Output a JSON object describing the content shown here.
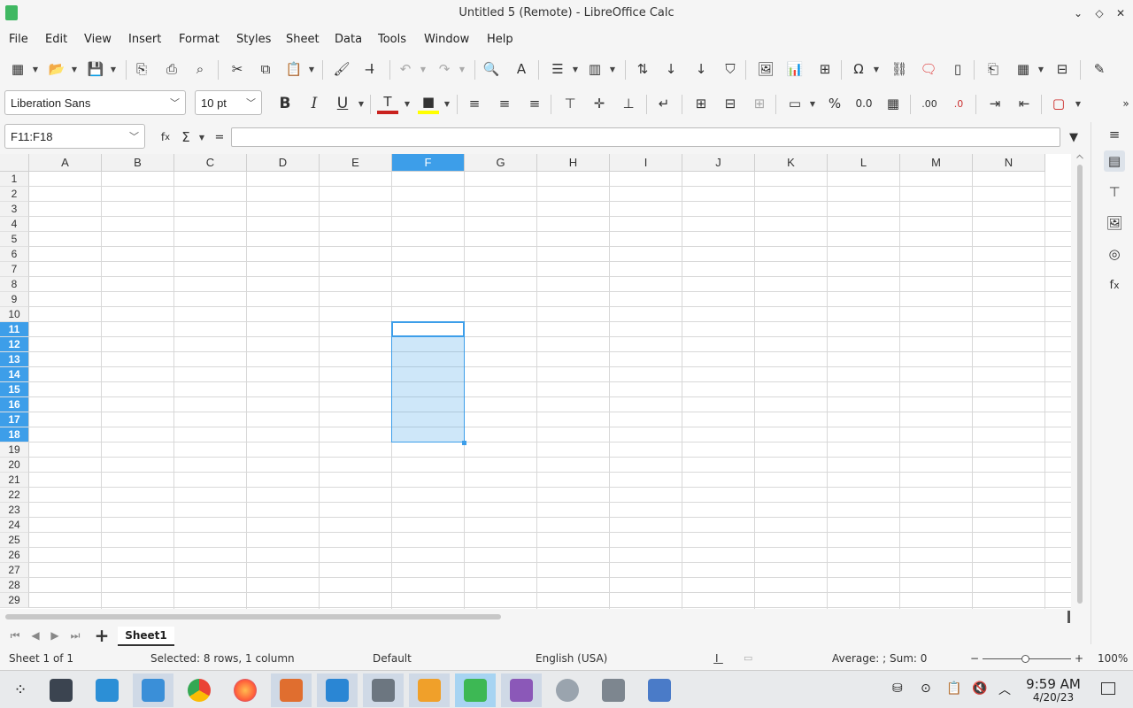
{
  "window": {
    "title": "Untitled 5 (Remote) - LibreOffice Calc"
  },
  "menu": [
    "File",
    "Edit",
    "View",
    "Insert",
    "Format",
    "Styles",
    "Sheet",
    "Data",
    "Tools",
    "Window",
    "Help"
  ],
  "format_toolbar": {
    "font_name": "Liberation Sans",
    "font_size": "10 pt"
  },
  "formula_bar": {
    "name_box": "F11:F18",
    "input": "",
    "equals": "="
  },
  "columns": [
    "A",
    "B",
    "C",
    "D",
    "E",
    "F",
    "G",
    "H",
    "I",
    "J",
    "K",
    "L",
    "M",
    "N"
  ],
  "selected_column": "F",
  "rows": [
    "1",
    "2",
    "3",
    "4",
    "5",
    "6",
    "7",
    "8",
    "9",
    "10",
    "11",
    "12",
    "13",
    "14",
    "15",
    "16",
    "17",
    "18",
    "19",
    "20",
    "21",
    "22",
    "23",
    "24",
    "25",
    "26",
    "27",
    "28",
    "29"
  ],
  "selected_rows": [
    "11",
    "12",
    "13",
    "14",
    "15",
    "16",
    "17",
    "18"
  ],
  "sheet_tabs": {
    "add_label": "+",
    "active": "Sheet1"
  },
  "status": {
    "sheet": "Sheet 1 of 1",
    "selection": "Selected: 8 rows, 1 column",
    "page_style": "Default",
    "language": "English (USA)",
    "sum": "Average: ; Sum: 0",
    "zoom": "100%"
  },
  "taskbar": {
    "time": "9:59 AM",
    "date": "4/20/23"
  },
  "colors": {
    "accent": "#3d9ee9",
    "selection_fill": "#c9e3f6"
  }
}
